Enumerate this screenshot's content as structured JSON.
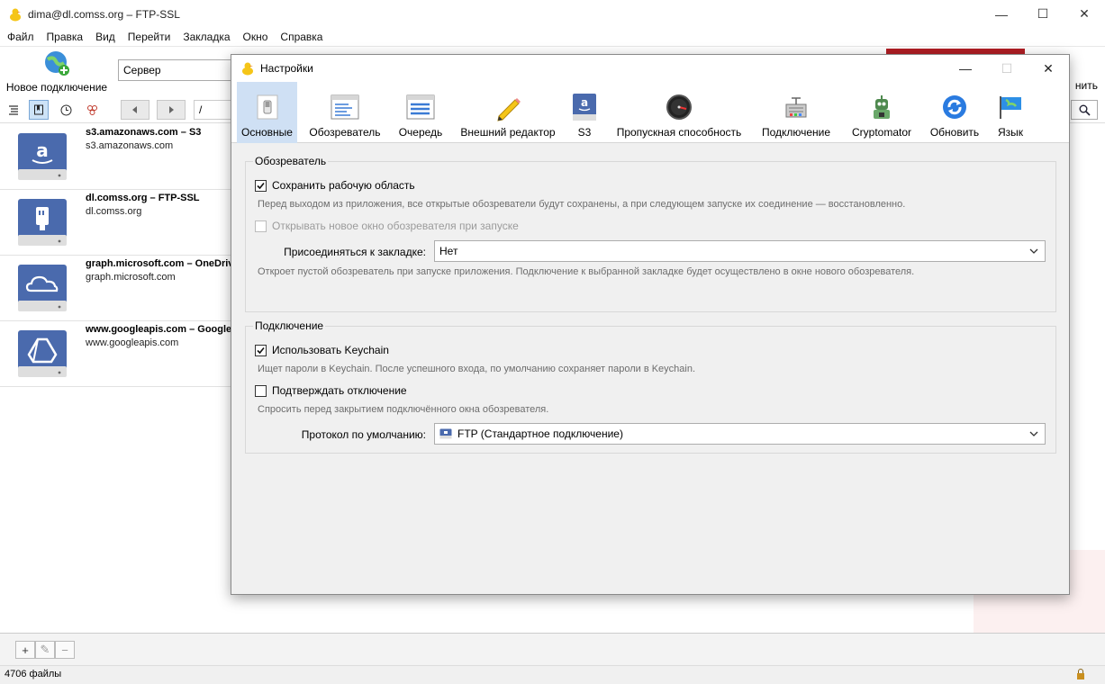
{
  "main_window": {
    "title": "dima@dl.comss.org – FTP-SSL",
    "controls": {
      "minimize": "—",
      "maximize": "☐",
      "close": "✕"
    }
  },
  "menu": [
    "Файл",
    "Правка",
    "Вид",
    "Перейти",
    "Закладка",
    "Окно",
    "Справка"
  ],
  "toolbar": {
    "new_connection": "Новое подключение",
    "server_field": "Сервер",
    "right_label": "нить"
  },
  "navbar": {
    "path": "/"
  },
  "bookmarks": [
    {
      "name": "s3.amazonaws.com – S3",
      "host": "s3.amazonaws.com",
      "icon": "amazon-icon"
    },
    {
      "name": "dl.comss.org – FTP-SSL",
      "host": "dl.comss.org",
      "icon": "network-plug-icon"
    },
    {
      "name": "graph.microsoft.com – OneDriv",
      "host": "graph.microsoft.com",
      "icon": "cloud-icon"
    },
    {
      "name": "www.googleapis.com – Google",
      "host": "www.googleapis.com",
      "icon": "drive-icon"
    }
  ],
  "bottombar": {
    "add": "+",
    "edit": "✎",
    "remove": "−"
  },
  "status": {
    "file_count": "4706 файлы"
  },
  "dialog": {
    "title": "Настройки",
    "tabs": [
      {
        "label": "Основные",
        "icon": "switch-icon"
      },
      {
        "label": "Обозреватель",
        "icon": "browser-window-icon"
      },
      {
        "label": "Очередь",
        "icon": "queue-icon"
      },
      {
        "label": "Внешний редактор",
        "icon": "pencil-icon"
      },
      {
        "label": "S3",
        "icon": "amazon-icon"
      },
      {
        "label": "Пропускная способность",
        "icon": "speedometer-icon"
      },
      {
        "label": "Подключение",
        "icon": "network-icon"
      },
      {
        "label": "Cryptomator",
        "icon": "robot-icon"
      },
      {
        "label": "Обновить",
        "icon": "refresh-icon"
      },
      {
        "label": "Язык",
        "icon": "flag-icon"
      }
    ],
    "browser_group": {
      "label": "Обозреватель",
      "save_workspace": {
        "label": "Сохранить рабочую область",
        "checked": true
      },
      "save_workspace_hint": "Перед выходом из приложения, все открытые обозреватели будут сохранены, а при следующем запуске их соединение — восстановленно.",
      "open_new_window": {
        "label": "Открывать новое окно обозревателя при запуске",
        "checked": false,
        "disabled": true
      },
      "connect_bookmark_label": "Присоединяться к закладке:",
      "connect_bookmark_value": "Нет",
      "connect_bookmark_hint": "Откроет пустой обозреватель при запуске приложения. Подключение к выбранной закладке будет осуществлено в окне нового обозревателя."
    },
    "connection_group": {
      "label": "Подключение",
      "use_keychain": {
        "label": "Использовать Keychain",
        "checked": true
      },
      "use_keychain_hint": "Ищет пароли в Keychain. После успешного входа, по умолчанию сохраняет пароли в Keychain.",
      "confirm_disconnect": {
        "label": "Подтверждать отключение",
        "checked": false
      },
      "confirm_disconnect_hint": "Спросить перед закрытием подключённого окна обозревателя.",
      "default_protocol_label": "Протокол по умолчанию:",
      "default_protocol_value": "FTP (Стандартное подключение)"
    }
  },
  "colors": {
    "accent_selected_tab": "#cfe0f4",
    "brand_red": "#b01e24",
    "disk_blue": "#4a6aad"
  }
}
